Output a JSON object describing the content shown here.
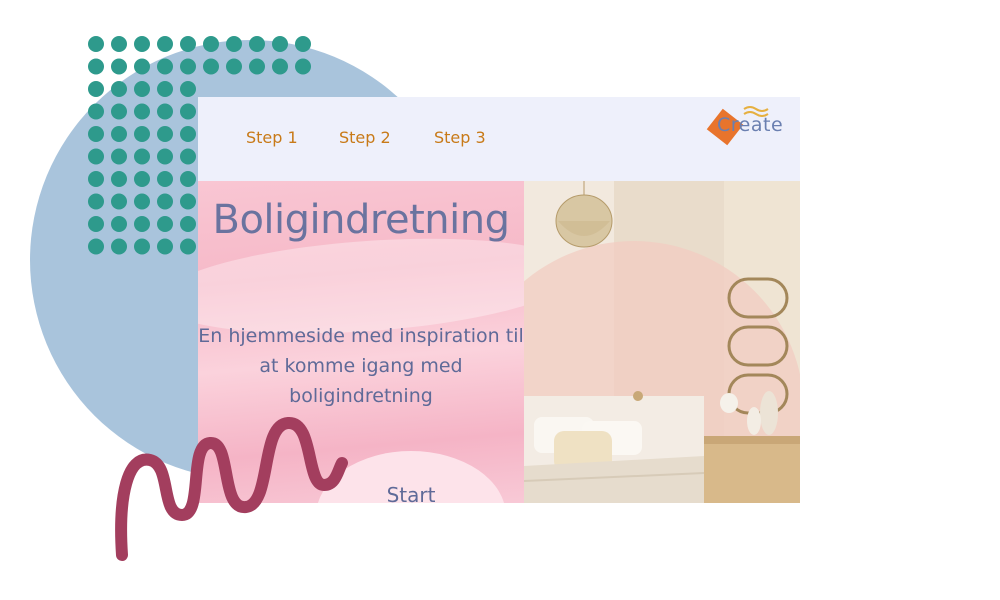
{
  "nav": {
    "items": [
      {
        "label": "Step 1"
      },
      {
        "label": "Step 2"
      },
      {
        "label": "Step 3"
      }
    ]
  },
  "logo": {
    "text": "Create"
  },
  "hero": {
    "title": "Boligindretning",
    "subtitle": "En hjemmeside med inspiration til at komme igang med boligindretning",
    "start_label": "Start"
  },
  "colors": {
    "nav_text": "#c87a18",
    "title_text": "#6a739f",
    "dots": "#2e9a8c",
    "squiggle": "#a33e5e",
    "circle_bg": "#a9c4dc",
    "logo_square": "#e8742c"
  },
  "icons": {
    "logo_mark": "diamond-square-logo-icon",
    "decor_dots": "dot-grid-icon",
    "decor_squiggle": "squiggle-icon"
  }
}
